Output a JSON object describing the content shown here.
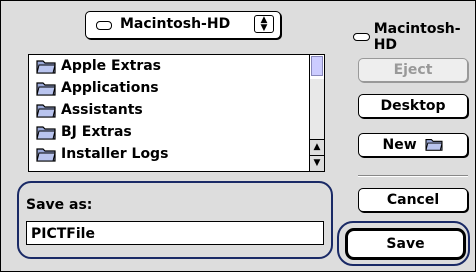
{
  "location_popup": {
    "label": "Macintosh-HD",
    "icon": "disk-icon",
    "arrows": "▲▼"
  },
  "volume": {
    "name": "Macintosh-HD",
    "icon": "disk-icon"
  },
  "file_list": {
    "items": [
      {
        "label": "Apple Extras",
        "icon": "folder-icon"
      },
      {
        "label": "Applications",
        "icon": "folder-icon"
      },
      {
        "label": "Assistants",
        "icon": "folder-icon"
      },
      {
        "label": "BJ Extras",
        "icon": "folder-icon"
      },
      {
        "label": "Installer Logs",
        "icon": "folder-icon"
      }
    ]
  },
  "buttons": {
    "eject": "Eject",
    "desktop": "Desktop",
    "new_folder": "New",
    "cancel": "Cancel",
    "save": "Save"
  },
  "save_as": {
    "label": "Save as:",
    "value": "PICTFile"
  }
}
